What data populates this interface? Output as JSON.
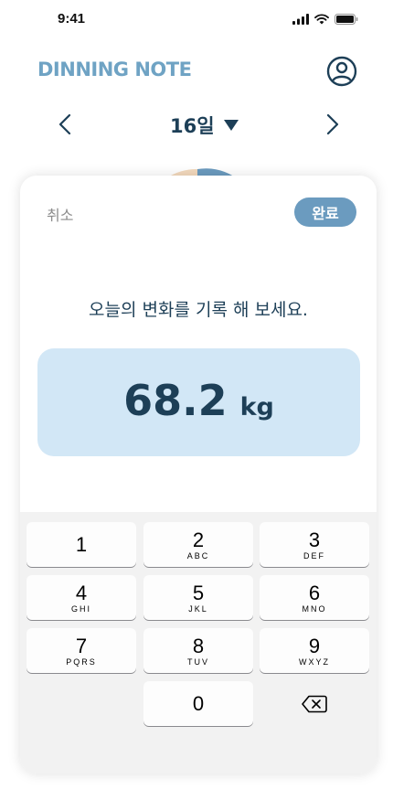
{
  "status": {
    "time": "9:41"
  },
  "header": {
    "app_title": "DINNING NOTE",
    "profile_icon": "user-circle-icon"
  },
  "date_nav": {
    "label": "16일",
    "prev_icon": "chevron-left-icon",
    "next_icon": "chevron-right-icon",
    "dropdown_icon": "caret-down-icon"
  },
  "sheet": {
    "cancel_label": "취소",
    "done_label": "완료",
    "prompt": "오늘의 변화를 기록 해 보세요.",
    "weight_value": "68.2",
    "weight_unit": "kg"
  },
  "keypad": {
    "keys": [
      {
        "digit": "1",
        "letters": ""
      },
      {
        "digit": "2",
        "letters": "ABC"
      },
      {
        "digit": "3",
        "letters": "DEF"
      },
      {
        "digit": "4",
        "letters": "GHI"
      },
      {
        "digit": "5",
        "letters": "JKL"
      },
      {
        "digit": "6",
        "letters": "MNO"
      },
      {
        "digit": "7",
        "letters": "PQRS"
      },
      {
        "digit": "8",
        "letters": "TUV"
      },
      {
        "digit": "9",
        "letters": "WXYZ"
      },
      {
        "digit": "0",
        "letters": ""
      }
    ],
    "delete_icon": "backspace-icon"
  },
  "colors": {
    "accent": "#6b9bbf",
    "primary_text": "#1d3f57",
    "input_bg": "#d2e7f6",
    "logo": "#6fa3c4"
  }
}
